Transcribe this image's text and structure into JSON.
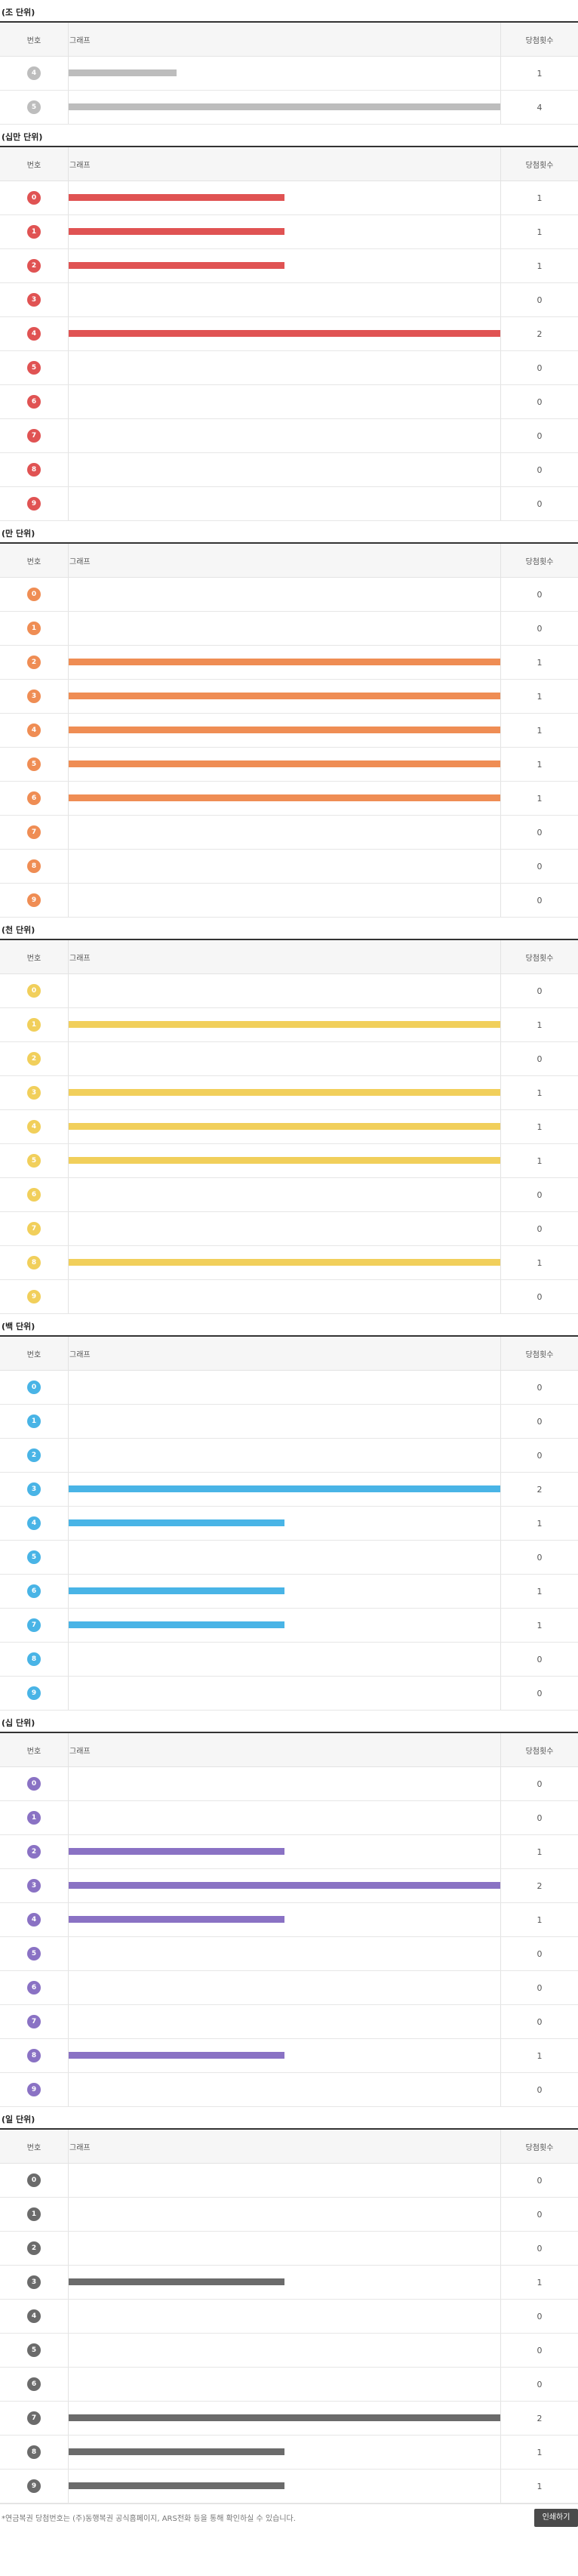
{
  "header": {
    "no": "번호",
    "graph": "그래프",
    "count": "당첨횟수"
  },
  "sections": [
    {
      "title": "(조 단위)",
      "color": "#bdbdbd",
      "max": 4,
      "rows": [
        {
          "num": "4",
          "count": 1
        },
        {
          "num": "5",
          "count": 4
        }
      ]
    },
    {
      "title": "(십만 단위)",
      "color": "#e05353",
      "max": 2,
      "rows": [
        {
          "num": "0",
          "count": 1
        },
        {
          "num": "1",
          "count": 1
        },
        {
          "num": "2",
          "count": 1
        },
        {
          "num": "3",
          "count": 0
        },
        {
          "num": "4",
          "count": 2
        },
        {
          "num": "5",
          "count": 0
        },
        {
          "num": "6",
          "count": 0
        },
        {
          "num": "7",
          "count": 0
        },
        {
          "num": "8",
          "count": 0
        },
        {
          "num": "9",
          "count": 0
        }
      ]
    },
    {
      "title": "(만 단위)",
      "color": "#ef8d54",
      "max": 1,
      "rows": [
        {
          "num": "0",
          "count": 0
        },
        {
          "num": "1",
          "count": 0
        },
        {
          "num": "2",
          "count": 1
        },
        {
          "num": "3",
          "count": 1
        },
        {
          "num": "4",
          "count": 1
        },
        {
          "num": "5",
          "count": 1
        },
        {
          "num": "6",
          "count": 1
        },
        {
          "num": "7",
          "count": 0
        },
        {
          "num": "8",
          "count": 0
        },
        {
          "num": "9",
          "count": 0
        }
      ]
    },
    {
      "title": "(천 단위)",
      "color": "#f1cf5b",
      "max": 1,
      "rows": [
        {
          "num": "0",
          "count": 0
        },
        {
          "num": "1",
          "count": 1
        },
        {
          "num": "2",
          "count": 0
        },
        {
          "num": "3",
          "count": 1
        },
        {
          "num": "4",
          "count": 1
        },
        {
          "num": "5",
          "count": 1
        },
        {
          "num": "6",
          "count": 0
        },
        {
          "num": "7",
          "count": 0
        },
        {
          "num": "8",
          "count": 1
        },
        {
          "num": "9",
          "count": 0
        }
      ]
    },
    {
      "title": "(백 단위)",
      "color": "#49b4e6",
      "max": 2,
      "rows": [
        {
          "num": "0",
          "count": 0
        },
        {
          "num": "1",
          "count": 0
        },
        {
          "num": "2",
          "count": 0
        },
        {
          "num": "3",
          "count": 2
        },
        {
          "num": "4",
          "count": 1
        },
        {
          "num": "5",
          "count": 0
        },
        {
          "num": "6",
          "count": 1
        },
        {
          "num": "7",
          "count": 1
        },
        {
          "num": "8",
          "count": 0
        },
        {
          "num": "9",
          "count": 0
        }
      ]
    },
    {
      "title": "(십 단위)",
      "color": "#8a72c4",
      "max": 2,
      "rows": [
        {
          "num": "0",
          "count": 0
        },
        {
          "num": "1",
          "count": 0
        },
        {
          "num": "2",
          "count": 1
        },
        {
          "num": "3",
          "count": 2
        },
        {
          "num": "4",
          "count": 1
        },
        {
          "num": "5",
          "count": 0
        },
        {
          "num": "6",
          "count": 0
        },
        {
          "num": "7",
          "count": 0
        },
        {
          "num": "8",
          "count": 1
        },
        {
          "num": "9",
          "count": 0
        }
      ]
    },
    {
      "title": "(일 단위)",
      "color": "#6b6b6b",
      "max": 2,
      "rows": [
        {
          "num": "0",
          "count": 0
        },
        {
          "num": "1",
          "count": 0
        },
        {
          "num": "2",
          "count": 0
        },
        {
          "num": "3",
          "count": 1
        },
        {
          "num": "4",
          "count": 0
        },
        {
          "num": "5",
          "count": 0
        },
        {
          "num": "6",
          "count": 0
        },
        {
          "num": "7",
          "count": 2
        },
        {
          "num": "8",
          "count": 1
        },
        {
          "num": "9",
          "count": 1
        }
      ]
    }
  ],
  "footer": {
    "note": "*연금복권 당첨번호는 (주)동행복권 공식홈페이지, ARS전화 등을 통해 확인하실 수 있습니다.",
    "print_label": "인쇄하기"
  }
}
